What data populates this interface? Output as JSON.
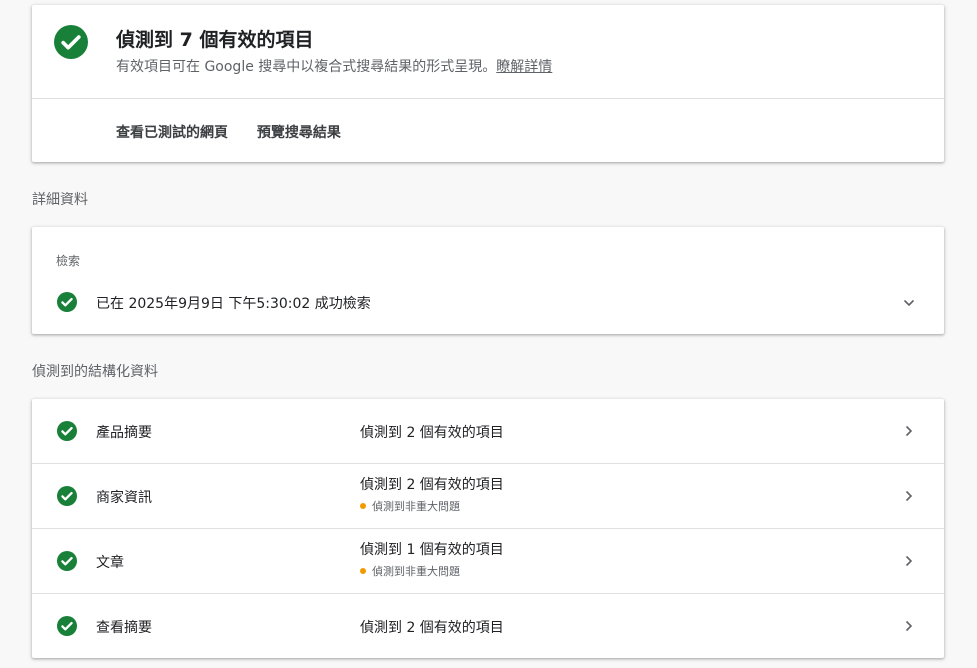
{
  "summary": {
    "title": "偵測到 7 個有效的項目",
    "subtitle": "有效項目可在 Google 搜尋中以複合式搜尋結果的形式呈現。",
    "learn_more": "瞭解詳情",
    "actions": [
      "查看已測試的網頁",
      "預覽搜尋結果"
    ]
  },
  "details": {
    "section_label": "詳細資料",
    "caption": "檢索",
    "message": "已在 2025年9月9日 下午5:30:02 成功檢索"
  },
  "structured": {
    "section_label": "偵測到的結構化資料",
    "items": [
      {
        "name": "產品摘要",
        "status": "偵測到 2 個有效的項目",
        "warning": ""
      },
      {
        "name": "商家資訊",
        "status": "偵測到 2 個有效的項目",
        "warning": "偵測到非重大問題"
      },
      {
        "name": "文章",
        "status": "偵測到 1 個有效的項目",
        "warning": "偵測到非重大問題"
      },
      {
        "name": "查看摘要",
        "status": "偵測到 2 個有效的項目",
        "warning": ""
      }
    ]
  },
  "colors": {
    "success": "#188038",
    "warning": "#f29900"
  }
}
